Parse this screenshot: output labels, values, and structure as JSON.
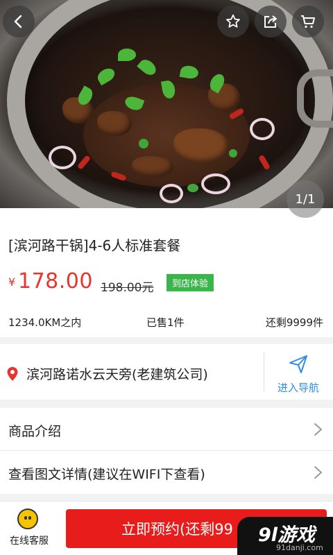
{
  "hero": {
    "page_indicator": "1/1",
    "icons": [
      "back-icon",
      "star-icon",
      "share-icon",
      "cart-icon"
    ]
  },
  "product": {
    "title": "[滨河路干锅]4-6人标准套餐",
    "currency": "¥",
    "price": "178.00",
    "original_price": "198.00元",
    "badge": "到店体验",
    "distance": "1234.0KM之内",
    "sold": "已售1件",
    "remaining": "还剩9999件"
  },
  "address": {
    "text": "滨河路诺水云天旁(老建筑公司)",
    "nav_label": "进入导航"
  },
  "menu": {
    "items": [
      {
        "label": "商品介绍"
      },
      {
        "label": "查看图文详情(建议在WIFI下查看)"
      }
    ]
  },
  "bottom": {
    "cs_label": "在线客服",
    "reserve_label": "立即预约(还剩99"
  },
  "watermark": {
    "main": "9l游戏",
    "sub": "91danji.com"
  },
  "colors": {
    "price": "#e8342d",
    "badge": "#3ab54a",
    "nav": "#2f8de4",
    "reserve": "#e91c1c"
  }
}
